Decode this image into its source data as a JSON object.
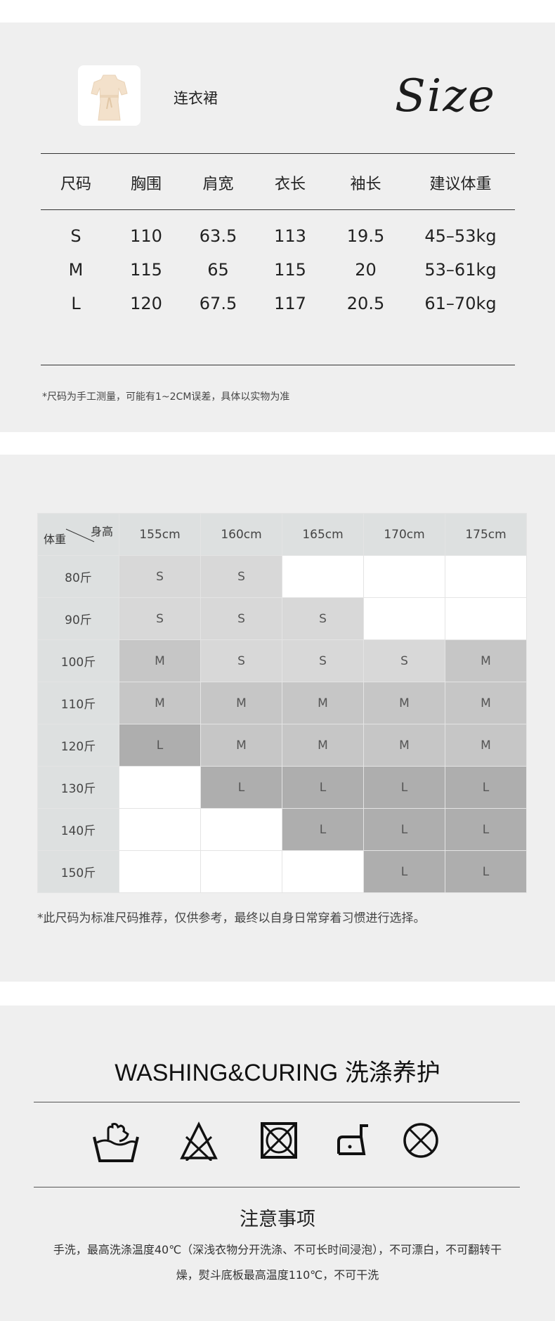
{
  "product": {
    "name": "连衣裙",
    "size_heading": "Size"
  },
  "size_table": {
    "headers": [
      "尺码",
      "胸围",
      "肩宽",
      "衣长",
      "袖长",
      "建议体重"
    ],
    "rows": [
      [
        "S",
        "110",
        "63.5",
        "113",
        "19.5",
        "45–53kg"
      ],
      [
        "M",
        "115",
        "65",
        "115",
        "20",
        "53–61kg"
      ],
      [
        "L",
        "120",
        "67.5",
        "117",
        "20.5",
        "61–70kg"
      ]
    ],
    "note": "*尺码为手工测量，可能有1~2CM误差，具体以实物为准"
  },
  "recommend_table": {
    "corner_weight": "体重",
    "corner_height": "身高",
    "heights": [
      "155cm",
      "160cm",
      "165cm",
      "170cm",
      "175cm"
    ],
    "weights": [
      "80斤",
      "90斤",
      "100斤",
      "110斤",
      "120斤",
      "130斤",
      "140斤",
      "150斤"
    ],
    "cells": [
      [
        "S",
        "S",
        "",
        "",
        ""
      ],
      [
        "S",
        "S",
        "S",
        "",
        ""
      ],
      [
        "M",
        "S",
        "S",
        "S",
        "M"
      ],
      [
        "M",
        "M",
        "M",
        "M",
        "M"
      ],
      [
        "L",
        "M",
        "M",
        "M",
        "M"
      ],
      [
        "",
        "L",
        "L",
        "L",
        "L"
      ],
      [
        "",
        "",
        "L",
        "L",
        "L"
      ],
      [
        "",
        "",
        "",
        "L",
        "L"
      ]
    ],
    "cell_colors": {
      "S": "#d8d8d8",
      "M": "#c6c6c6",
      "L": "#aeaeae",
      "empty": "#ffffff",
      "header": "#dde0e0"
    },
    "note": "*此尺码为标准尺码推荐，仅供参考，最终以自身日常穿着习惯进行选择。"
  },
  "washing": {
    "title": "WASHING&CURING 洗涤养护",
    "icons": [
      "hand-wash-icon",
      "no-bleach-icon",
      "no-tumble-dry-icon",
      "iron-icon",
      "no-dry-clean-icon"
    ],
    "notice_title": "注意事项",
    "notice_line1": "手洗，最高洗涤温度40℃（深浅衣物分开洗涤、不可长时间浸泡），不可漂白，不可翻转干",
    "notice_line2": "燥，熨斗底板最高温度110℃，不可干洗"
  }
}
